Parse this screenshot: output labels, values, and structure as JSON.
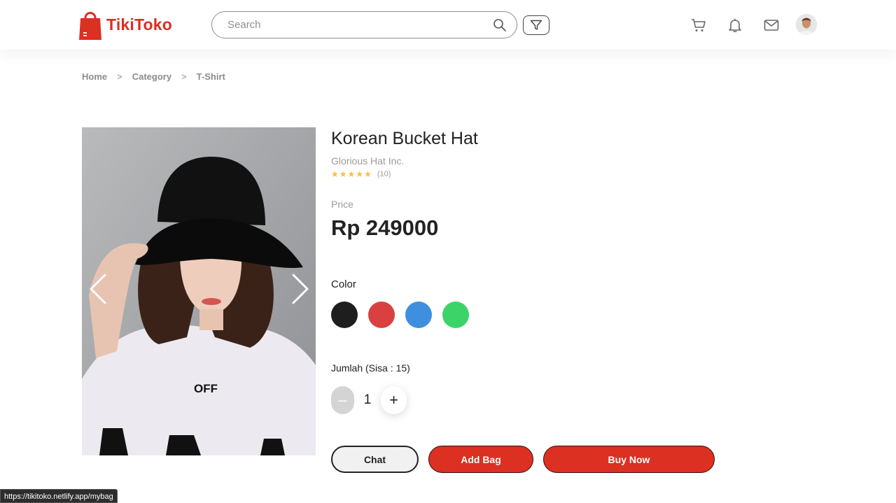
{
  "header": {
    "logo_text": "TikiToko",
    "search_placeholder": "Search",
    "icons": [
      "cart-icon",
      "bell-icon",
      "mail-icon",
      "filter-icon",
      "search-icon"
    ]
  },
  "breadcrumb": {
    "items": [
      "Home",
      "Category",
      "T-Shirt"
    ],
    "separator": ">"
  },
  "product": {
    "title": "Korean Bucket Hat",
    "brand": "Glorious Hat Inc.",
    "rating_stars": 5,
    "rating_count": "(10)",
    "price_label": "Price",
    "price": "Rp 249000",
    "image_text": "OFF",
    "color_label": "Color",
    "colors": [
      "#1e1e1e",
      "#d94040",
      "#3e8fde",
      "#3cd468"
    ],
    "quantity_label": "Jumlah (Sisa : 15)",
    "quantity": "1",
    "minus_symbol": "–",
    "plus_symbol": "+"
  },
  "actions": {
    "chat": "Chat",
    "add_bag": "Add Bag",
    "buy_now": "Buy Now"
  },
  "status_url": "https://tikitoko.netlify.app/mybag",
  "colors": {
    "accent": "#db3022",
    "star": "#ffba49",
    "muted": "#9b9b9b"
  }
}
